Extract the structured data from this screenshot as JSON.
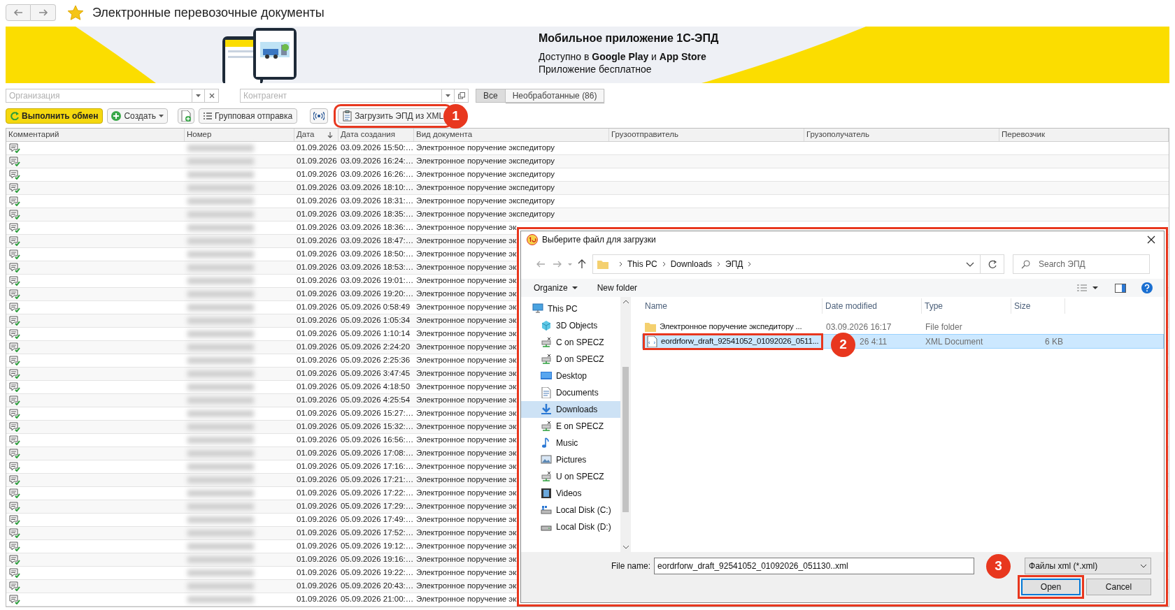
{
  "window": {
    "title": "Электронные перевозочные документы",
    "favorite": true
  },
  "banner": {
    "heading": "Мобильное приложение 1С-ЭПД",
    "line1": "Доступно в **Google Play** и **App Store**",
    "line2": "Приложение бесплатное"
  },
  "filters": {
    "organization": {
      "placeholder": "Организация"
    },
    "counterparty": {
      "placeholder": "Контрагент"
    },
    "segments": [
      {
        "label": "Все",
        "selected": true
      },
      {
        "label": "Необработанные (86)",
        "selected": false
      }
    ]
  },
  "toolbar": [
    {
      "kind": "exchange",
      "label": "Выполнить обмен"
    },
    {
      "kind": "create",
      "label": "Создать"
    },
    {
      "kind": "new-doc"
    },
    {
      "kind": "group",
      "label": "Групповая отправка"
    },
    {
      "kind": "signal"
    },
    {
      "kind": "load",
      "label": "Загрузить ЭПД из XML",
      "callout": "1"
    }
  ],
  "table": {
    "columns": [
      {
        "label": "Комментарий",
        "sorted": false
      },
      {
        "label": "Номер",
        "sorted": false
      },
      {
        "label": "Дата",
        "sorted": true
      },
      {
        "label": "Дата создания",
        "sorted": false
      },
      {
        "label": "Вид документа",
        "sorted": false
      },
      {
        "label": "Грузоотправитель",
        "sorted": false
      },
      {
        "label": "Грузополучатель",
        "sorted": false
      },
      {
        "label": "Перевозчик",
        "sorted": false
      }
    ],
    "rows": [
      {
        "date": "01.09.2026",
        "created": "03.09.2026 15:50:…",
        "doc_type": "Электронное поручение экспедитору"
      },
      {
        "date": "01.09.2026",
        "created": "03.09.2026 16:24:…",
        "doc_type": "Электронное поручение экспедитору"
      },
      {
        "date": "01.09.2026",
        "created": "03.09.2026 16:26:…",
        "doc_type": "Электронное поручение экспедитору"
      },
      {
        "date": "01.09.2026",
        "created": "03.09.2026 18:10:…",
        "doc_type": "Электронное поручение экспедитору"
      },
      {
        "date": "01.09.2026",
        "created": "03.09.2026 18:31:…",
        "doc_type": "Электронное поручение экспедитору"
      },
      {
        "date": "01.09.2026",
        "created": "03.09.2026 18:35:…",
        "doc_type": "Электронное поручение экспедитору"
      },
      {
        "date": "01.09.2026",
        "created": "03.09.2026 18:36:…",
        "doc_type": "Электронное поручение эк"
      },
      {
        "date": "01.09.2026",
        "created": "03.09.2026 18:47:…",
        "doc_type": "Электронное поручение эк"
      },
      {
        "date": "01.09.2026",
        "created": "03.09.2026 18:50:…",
        "doc_type": "Электронное поручение эк"
      },
      {
        "date": "01.09.2026",
        "created": "03.09.2026 18:53:…",
        "doc_type": "Электронное поручение эк"
      },
      {
        "date": "01.09.2026",
        "created": "03.09.2026 19:01:…",
        "doc_type": "Электронное поручение эк"
      },
      {
        "date": "01.09.2026",
        "created": "03.09.2026 19:20:…",
        "doc_type": "Электронное поручение эк"
      },
      {
        "date": "01.09.2026",
        "created": "05.09.2026 0:58:49",
        "doc_type": "Электронное поручение эк"
      },
      {
        "date": "01.09.2026",
        "created": "05.09.2026 1:05:34",
        "doc_type": "Электронное поручение эк"
      },
      {
        "date": "01.09.2026",
        "created": "05.09.2026 1:10:14",
        "doc_type": "Электронное поручение эк"
      },
      {
        "date": "01.09.2026",
        "created": "05.09.2026 2:24:20",
        "doc_type": "Электронное поручение эк"
      },
      {
        "date": "01.09.2026",
        "created": "05.09.2026 2:25:36",
        "doc_type": "Электронное поручение эк"
      },
      {
        "date": "01.09.2026",
        "created": "05.09.2026 3:47:45",
        "doc_type": "Электронное поручение эк"
      },
      {
        "date": "01.09.2026",
        "created": "05.09.2026 4:18:50",
        "doc_type": "Электронное поручение эк"
      },
      {
        "date": "01.09.2026",
        "created": "05.09.2026 4:25:54",
        "doc_type": "Электронное поручение эк"
      },
      {
        "date": "01.09.2026",
        "created": "05.09.2026 15:27:…",
        "doc_type": "Электронное поручение эк"
      },
      {
        "date": "01.09.2026",
        "created": "05.09.2026 15:32:…",
        "doc_type": "Электронное поручение эк"
      },
      {
        "date": "01.09.2026",
        "created": "05.09.2026 16:56:…",
        "doc_type": "Электронное поручение эк"
      },
      {
        "date": "01.09.2026",
        "created": "05.09.2026 17:08:…",
        "doc_type": "Электронное поручение эк"
      },
      {
        "date": "01.09.2026",
        "created": "05.09.2026 17:16:…",
        "doc_type": "Электронное поручение эк"
      },
      {
        "date": "01.09.2026",
        "created": "05.09.2026 17:21:…",
        "doc_type": "Электронное поручение эк"
      },
      {
        "date": "01.09.2026",
        "created": "05.09.2026 17:22:…",
        "doc_type": "Электронное поручение эк"
      },
      {
        "date": "01.09.2026",
        "created": "05.09.2026 17:29:…",
        "doc_type": "Электронное поручение эк"
      },
      {
        "date": "01.09.2026",
        "created": "05.09.2026 17:49:…",
        "doc_type": "Электронное поручение эк"
      },
      {
        "date": "01.09.2026",
        "created": "05.09.2026 17:52:…",
        "doc_type": "Электронное поручение эк"
      },
      {
        "date": "01.09.2026",
        "created": "05.09.2026 19:12:…",
        "doc_type": "Электронное поручение эк"
      },
      {
        "date": "01.09.2026",
        "created": "05.09.2026 19:16:…",
        "doc_type": "Электронное поручение эк"
      },
      {
        "date": "01.09.2026",
        "created": "05.09.2026 19:22:…",
        "doc_type": "Электронное поручение эк"
      },
      {
        "date": "01.09.2026",
        "created": "05.09.2026 20:43:…",
        "doc_type": "Электронное поручение эк"
      },
      {
        "date": "01.09.2026",
        "created": "05.09.2026 21:00:…",
        "doc_type": "Электронное поручение эк"
      }
    ]
  },
  "dialog": {
    "title": "Выберите файл для загрузки",
    "path": [
      "This PC",
      "Downloads",
      "ЭПД"
    ],
    "search": {
      "placeholder": "Search ЭПД"
    },
    "commands": [
      "Organize",
      "New folder"
    ],
    "nav": [
      {
        "kind": "pc",
        "label": "This PC",
        "selected": false
      },
      {
        "kind": "cube",
        "label": "3D Objects",
        "selected": false
      },
      {
        "kind": "netdrive",
        "label": "C on SPECZ",
        "selected": false
      },
      {
        "kind": "netdrive",
        "label": "D on SPECZ",
        "selected": false
      },
      {
        "kind": "desktop",
        "label": "Desktop",
        "selected": false
      },
      {
        "kind": "docs",
        "label": "Documents",
        "selected": false
      },
      {
        "kind": "download",
        "label": "Downloads",
        "selected": true
      },
      {
        "kind": "netdrive",
        "label": "E on SPECZ",
        "selected": false
      },
      {
        "kind": "music",
        "label": "Music",
        "selected": false
      },
      {
        "kind": "pictures",
        "label": "Pictures",
        "selected": false
      },
      {
        "kind": "netdrive",
        "label": "U on SPECZ",
        "selected": false
      },
      {
        "kind": "videos",
        "label": "Videos",
        "selected": false
      },
      {
        "kind": "windisk",
        "label": "Local Disk (C:)",
        "selected": false
      },
      {
        "kind": "disk",
        "label": "Local Disk (D:)",
        "selected": false
      }
    ],
    "columns": [
      "Name",
      "Date modified",
      "Type",
      "Size"
    ],
    "files": [
      {
        "kind": "folder",
        "name": "Электронное поручение экспедитору ...",
        "date": "03.09.2026 16:17",
        "type": "File folder",
        "selected": false
      },
      {
        "kind": "xml",
        "name": "eordrforw_draft_92541052_01092026_0511...",
        "date": "26 4:11",
        "type": "XML Document",
        "size": "6 KB",
        "selected": true,
        "callout": "2"
      }
    ],
    "file_name_label": "File name:",
    "file_name": "eordrforw_draft_92541052_01092026_051130..xml",
    "file_type": "Файлы xml (*.xml)",
    "buttons": [
      {
        "kind": "open",
        "label": "Open",
        "callout": "3"
      },
      {
        "kind": "cancel",
        "label": "Cancel"
      }
    ]
  }
}
